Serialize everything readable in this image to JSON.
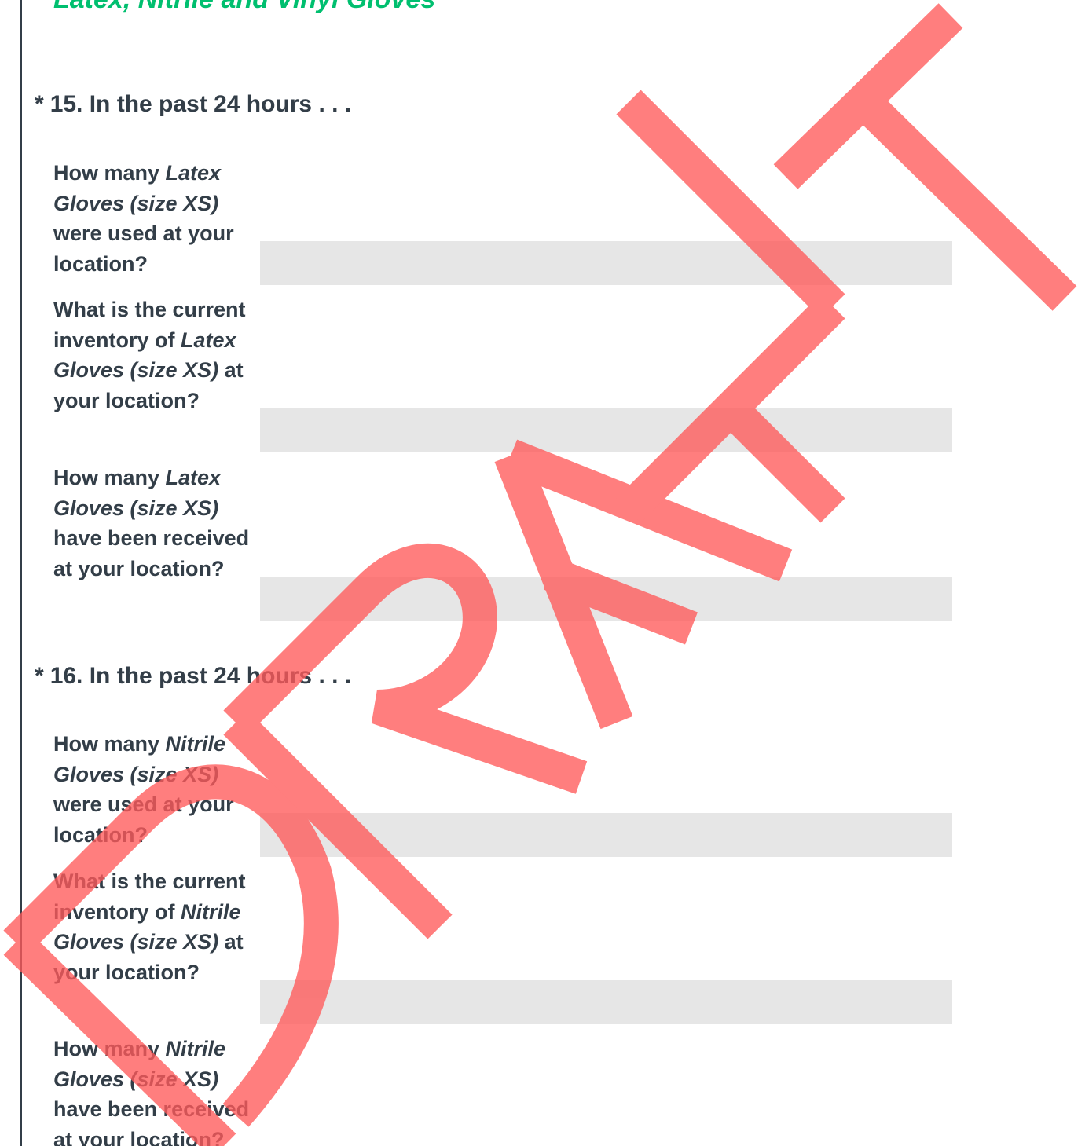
{
  "section": {
    "title": "Latex, Nitrile and Vinyl Gloves"
  },
  "questions": [
    {
      "asterisk": "*",
      "title": "15. In the past 24 hours . . .",
      "rows": [
        {
          "pre": "How many ",
          "item": "Latex Gloves (size XS)",
          "post": " were used at your location?",
          "value": ""
        },
        {
          "pre": "What is the current inventory of ",
          "item": "Latex Gloves (size XS)",
          "post": " at your location?",
          "value": ""
        },
        {
          "pre": "How many ",
          "item": "Latex Gloves (size XS)",
          "post": " have been received at your location?",
          "value": ""
        }
      ]
    },
    {
      "asterisk": "*",
      "title": "16. In the past 24 hours . . .",
      "rows": [
        {
          "pre": "How many ",
          "item": "Nitrile Gloves (size XS)",
          "post": " were used at your location?",
          "value": ""
        },
        {
          "pre": "What is the current inventory of ",
          "item": "Nitrile Gloves (size XS)",
          "post": " at your location?",
          "value": ""
        },
        {
          "pre": "How many ",
          "item": "Nitrile Gloves (size XS)",
          "post": " have been received at your location?",
          "value": ""
        }
      ]
    }
  ],
  "watermark": {
    "text": "DRAFT",
    "color": "#ff5a5a"
  },
  "colors": {
    "accent": "#00bf6f",
    "text": "#333e48",
    "input_bg": "#e6e6e6"
  }
}
